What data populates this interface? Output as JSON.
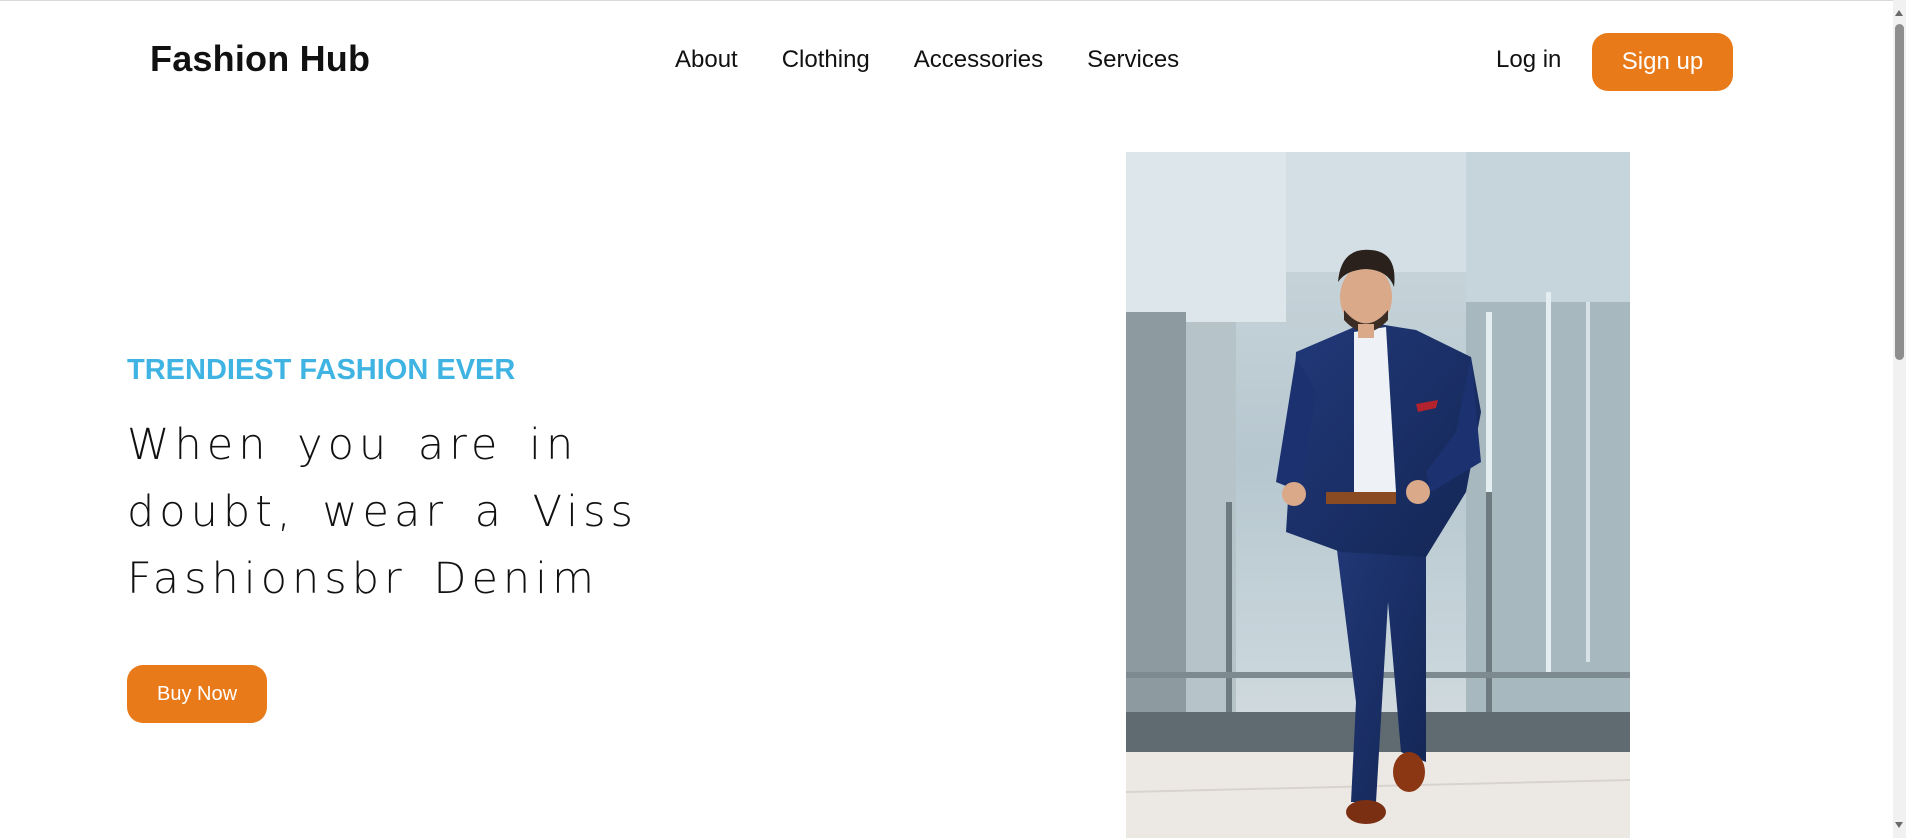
{
  "header": {
    "brand": "Fashion Hub",
    "nav": [
      {
        "label": "About"
      },
      {
        "label": "Clothing"
      },
      {
        "label": "Accessories"
      },
      {
        "label": "Services"
      }
    ],
    "login_label": "Log in",
    "signup_label": "Sign up"
  },
  "hero": {
    "eyebrow": "TRENDIEST FASHION EVER",
    "headline": "When you are in doubt, wear a Viss Fashionsbr Denim",
    "cta_label": "Buy Now",
    "image_alt": "man-in-navy-suit-photo"
  },
  "colors": {
    "accent": "#e87a1a",
    "eyebrow": "#3fb4e3",
    "text": "#111111"
  }
}
